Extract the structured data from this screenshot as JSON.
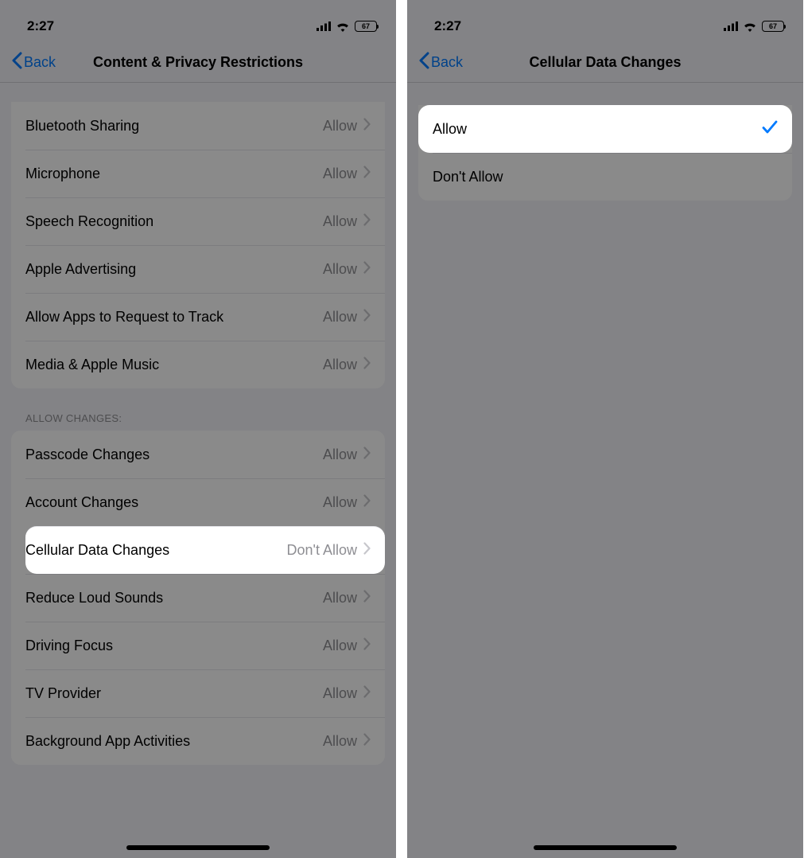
{
  "left": {
    "status": {
      "time": "2:27",
      "battery": "67"
    },
    "nav": {
      "back": "Back",
      "title": "Content & Privacy Restrictions"
    },
    "group1": [
      {
        "label": "Bluetooth Sharing",
        "value": "Allow"
      },
      {
        "label": "Microphone",
        "value": "Allow"
      },
      {
        "label": "Speech Recognition",
        "value": "Allow"
      },
      {
        "label": "Apple Advertising",
        "value": "Allow"
      },
      {
        "label": "Allow Apps to Request to Track",
        "value": "Allow"
      },
      {
        "label": "Media & Apple Music",
        "value": "Allow"
      }
    ],
    "section_header": "ALLOW CHANGES:",
    "group2": [
      {
        "label": "Passcode Changes",
        "value": "Allow"
      },
      {
        "label": "Account Changes",
        "value": "Allow"
      },
      {
        "label": "Cellular Data Changes",
        "value": "Don't Allow",
        "highlight": true
      },
      {
        "label": "Reduce Loud Sounds",
        "value": "Allow"
      },
      {
        "label": "Driving Focus",
        "value": "Allow"
      },
      {
        "label": "TV Provider",
        "value": "Allow"
      },
      {
        "label": "Background App Activities",
        "value": "Allow"
      }
    ]
  },
  "right": {
    "status": {
      "time": "2:27",
      "battery": "67"
    },
    "nav": {
      "back": "Back",
      "title": "Cellular Data Changes"
    },
    "options": [
      {
        "label": "Allow",
        "selected": true,
        "highlight": true
      },
      {
        "label": "Don't Allow",
        "selected": false
      }
    ]
  }
}
